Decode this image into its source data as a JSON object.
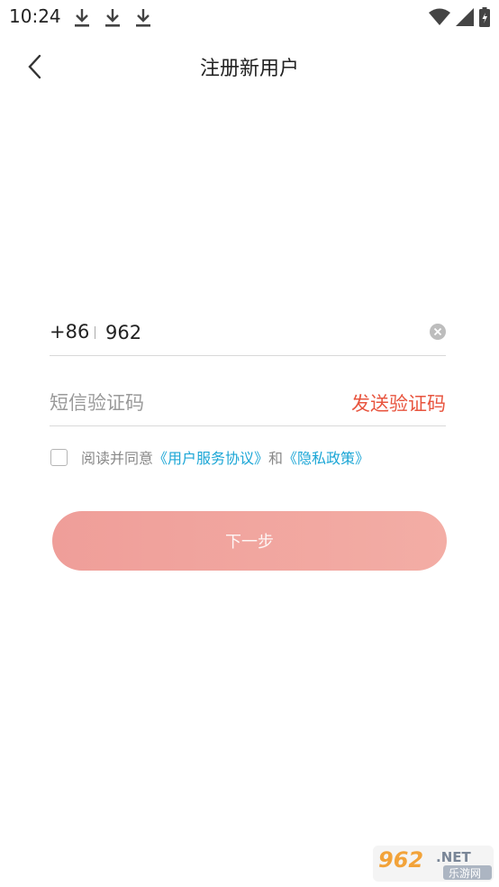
{
  "status_bar": {
    "time": "10:24",
    "download_icons": [
      "download-icon",
      "download-icon",
      "download-icon"
    ],
    "system_icons": [
      "wifi-icon",
      "signal-icon",
      "battery-icon"
    ]
  },
  "nav": {
    "back_icon": "chevron-left-icon",
    "title": "注册新用户"
  },
  "form": {
    "country_code": "+86",
    "phone_value": "962",
    "clear_icon": "clear-circle-icon",
    "code_placeholder": "短信验证码",
    "send_code_label": "发送验证码"
  },
  "agreement": {
    "prefix": "阅读并同意",
    "terms_link": "《用户服务协议》",
    "conjunction": "和",
    "privacy_link": "《隐私政策》"
  },
  "next_button": {
    "label": "下一步"
  },
  "watermark": {
    "line1": "962.NET",
    "line2": "乐游网"
  },
  "colors": {
    "accent_red": "#e8553f",
    "link_blue": "#1ba6d6",
    "button_start": "#ef9e99",
    "button_end": "#f3ada5"
  }
}
